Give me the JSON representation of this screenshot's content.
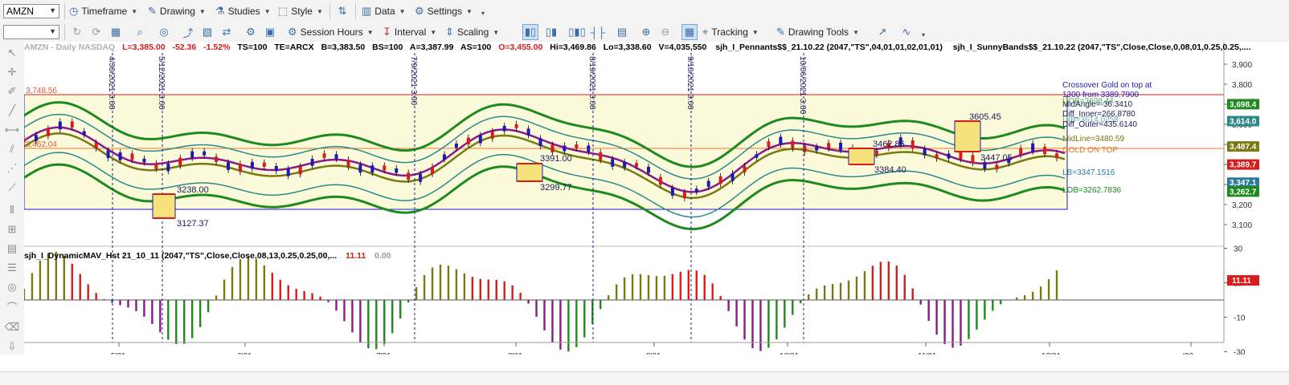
{
  "symbol_combo": {
    "value": "AMZN"
  },
  "toolbar1": [
    {
      "label": "Timeframe",
      "icon": "clock-icon"
    },
    {
      "label": "Drawing",
      "icon": "pencil-icon"
    },
    {
      "label": "Studies",
      "icon": "flask-icon"
    },
    {
      "label": "Style",
      "icon": "style-icon"
    },
    {
      "label": "Data",
      "icon": "data-icon"
    },
    {
      "label": "Settings",
      "icon": "gear-icon"
    }
  ],
  "toolbar2": {
    "session_hours": "Session Hours",
    "interval": "Interval",
    "scaling": "Scaling",
    "tracking": "Tracking",
    "drawing_tools": "Drawing Tools"
  },
  "header": {
    "symbol_desc": "AMZN - Daily  NASDAQ",
    "last": "L=3,385.00",
    "change": "-52.36",
    "pct": "-1.52%",
    "ts": "TS=100",
    "te": "TE=ARCX",
    "bid": "B=3,383.50",
    "bs": "BS=100",
    "ask": "A=3,387.99",
    "as": "AS=100",
    "open": "O=3,455.00",
    "hi": "Hi=3,469.86",
    "lo": "Lo=3,338.60",
    "vol": "V=4,035,550",
    "study1": "sjh_I_Pennants$$_21.10.22 (2047,\"TS\",04,01,01,02,01,01)",
    "study2": "sjh_I_SunnyBands$$_21.10.22 (2047,\"TS\",Close,Close,0,08,01,0.25,0.25,...."
  },
  "sub_header": {
    "name": "sjh_I_DynamicMAV_Hst 21_10_11 (2047,\"TS\",Close,Close,08,13,0.25,0.25,00,...",
    "v1": "11.11",
    "v2": "0.00"
  },
  "vertical_dates": [
    "4/30/2021  3:00",
    "5/12/2021  3:00",
    "7/9/2021  3:00",
    "8/19/2021  3:00",
    "9/10/2021  3:00",
    "10/06/2021  3:00"
  ],
  "level_labels": {
    "top": "3,748.56",
    "mid": "3,462.04"
  },
  "annotations": {
    "a3391": "3391.00",
    "a3299": "3299.77",
    "a3238": "3238.00",
    "a3127": "3127.37",
    "a3462": "3462.86",
    "a3384": "3384.40",
    "a3605": "3605.45",
    "a3447": "3447.05"
  },
  "info_panel": {
    "cross": "Crossover Gold on top at",
    "cross2": "1300 from 3389.7900",
    "mid_angle": "MidAngle=-36.3410",
    "diff_inner": "Diff_Inner=266.8780",
    "diff_outer": "Diff_Outer=435.6140",
    "uob": "UOB=3698.44",
    "uib": "UIB=3614.0258",
    "midline": "MidLine=3480.59",
    "gold": "GOLD ON TOP",
    "lb": "LB=3347.1516",
    "lob": "LOB=3262.7836"
  },
  "price_axis": {
    "ticks": [
      "3,900",
      "3,800",
      "3,700",
      "3,600",
      "3,500",
      "3,400",
      "3,300",
      "3,200",
      "3,100"
    ],
    "badges": [
      {
        "text": "3,698.4",
        "color": "#1e8a1e"
      },
      {
        "text": "3,614.0",
        "color": "#2a8a8a"
      },
      {
        "text": "3,487.4",
        "color": "#7a7a10"
      },
      {
        "text": "3,389.7",
        "color": "#d81b1b"
      },
      {
        "text": "3,347.1",
        "color": "#2a7a9a"
      },
      {
        "text": "3,262.7",
        "color": "#1e8a1e"
      }
    ]
  },
  "sub_axis": {
    "ticks": [
      "30",
      "10",
      "-10",
      "-30"
    ],
    "badge": "11.11"
  },
  "time_axis": [
    "5'21",
    "6'21",
    "7'21",
    "8'21",
    "9'21",
    "10'21",
    "11'21",
    "12'21",
    "'22"
  ],
  "colors": {
    "up": "#1a1ab4",
    "down": "#d81b1b",
    "green": "#1e8a1e",
    "teal": "#2a8a8a",
    "olive": "#7a7a10",
    "purple": "#8a1a8a",
    "zone": "#fbfbdc"
  }
}
